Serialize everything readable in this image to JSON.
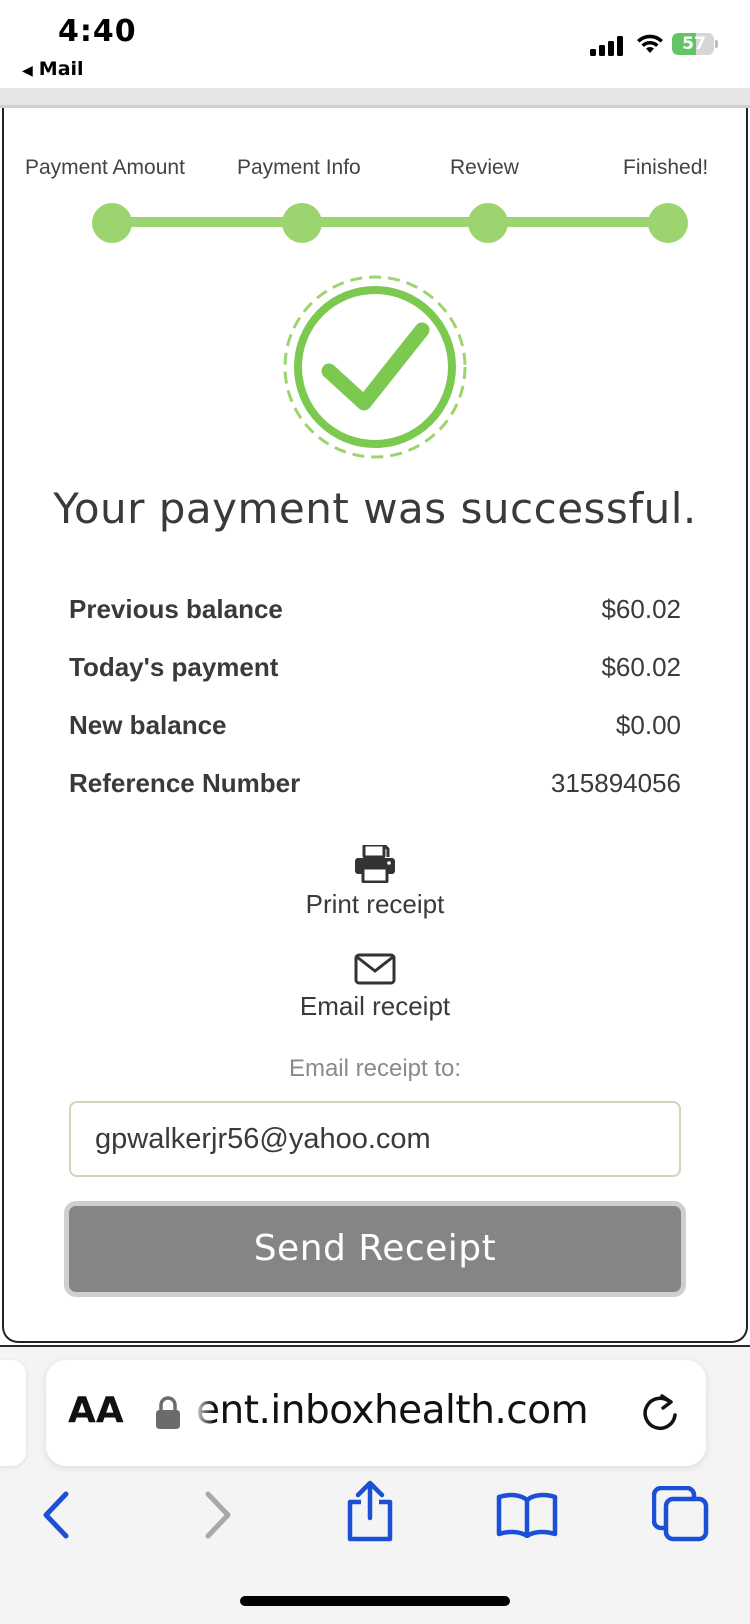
{
  "status_bar": {
    "time": "4:40",
    "back_app": "Mail",
    "battery_percent": 57
  },
  "steps": [
    {
      "label": "Payment Amount",
      "completed": true
    },
    {
      "label": "Payment Info",
      "completed": true
    },
    {
      "label": "Review",
      "completed": true
    },
    {
      "label": "Finished!",
      "completed": true
    }
  ],
  "headline": "Your payment was successful.",
  "summary": [
    {
      "label": "Previous balance",
      "value": "$60.02"
    },
    {
      "label": "Today's payment",
      "value": "$60.02"
    },
    {
      "label": "New balance",
      "value": "$0.00"
    },
    {
      "label": "Reference Number",
      "value": "315894056"
    }
  ],
  "actions": {
    "print_label": "Print receipt",
    "email_label": "Email receipt"
  },
  "email_form": {
    "label": "Email receipt to:",
    "value": "gpwalkerjr56@yahoo.com",
    "button_label": "Send Receipt"
  },
  "browser": {
    "aa_label": "AA",
    "url": "ent.inboxhealth.com"
  },
  "colors": {
    "accent_green": "#9cd56f",
    "check_green": "#7cc94f",
    "button_gray": "#858585",
    "ios_blue": "#1b4fd6"
  },
  "icons": [
    "signal-icon",
    "wifi-icon",
    "battery-icon",
    "checkmark-icon",
    "printer-icon",
    "envelope-icon",
    "lock-icon",
    "reload-icon",
    "back-icon",
    "forward-icon",
    "share-icon",
    "bookmarks-icon",
    "tabs-icon"
  ]
}
